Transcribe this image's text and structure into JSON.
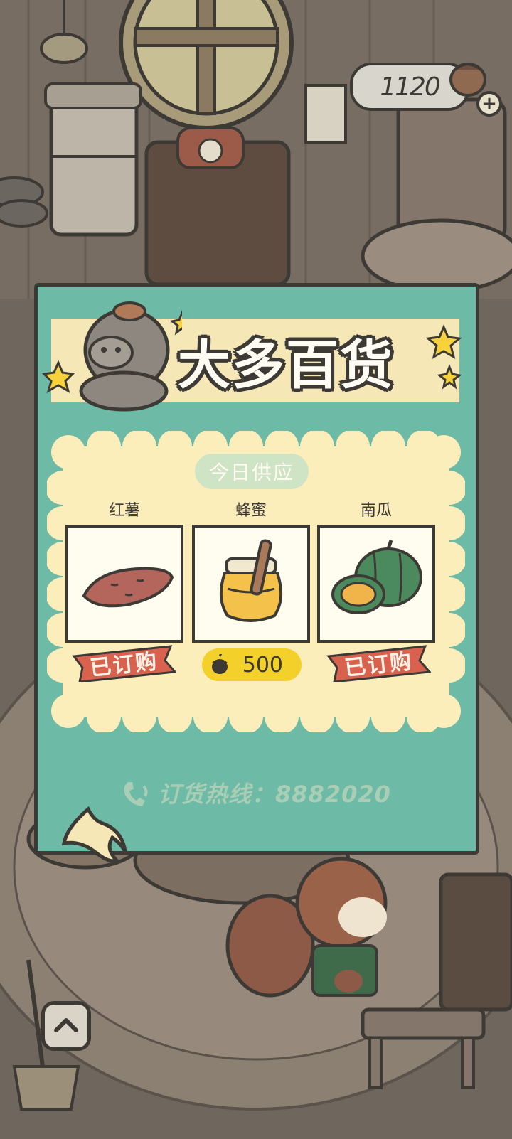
{
  "currency": {
    "amount": "1120",
    "coin_pouch_icon": "acorn-pouch-icon",
    "add_icon": "plus-icon"
  },
  "shop": {
    "title": "大多百货",
    "mascot_icon": "hippo-shopkeeper-icon",
    "today_label": "今日供应",
    "items": [
      {
        "name": "红薯",
        "icon": "sweet-potato-icon",
        "status": "已订购"
      },
      {
        "name": "蜂蜜",
        "icon": "honey-jar-icon",
        "price": "500"
      },
      {
        "name": "南瓜",
        "icon": "pumpkin-icon",
        "status": "已订购"
      }
    ],
    "hotline": "订货热线：8882020"
  },
  "nav": {
    "back_icon": "back-arrow-icon",
    "up_icon": "chevron-up-icon"
  },
  "colors": {
    "modal_bg": "#6dbaa6",
    "panel_bg": "#fbeebb",
    "ribbon": "#d9624f",
    "price_pill": "#f4d12a",
    "outline": "#3d3a36"
  }
}
